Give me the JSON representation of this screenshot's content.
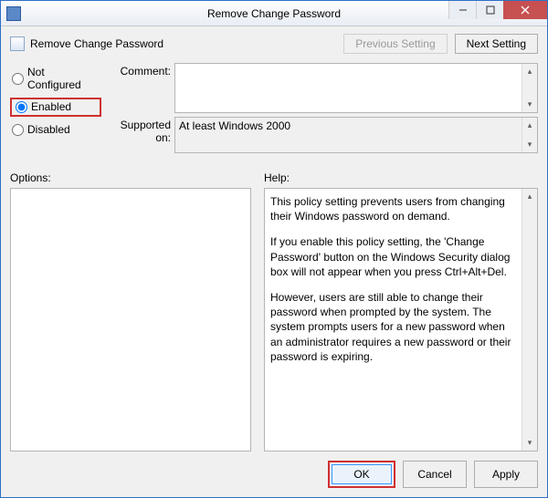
{
  "window": {
    "title": "Remove Change Password"
  },
  "header": {
    "policy_name": "Remove Change Password",
    "previous_setting": "Previous Setting",
    "next_setting": "Next Setting"
  },
  "radios": {
    "not_configured": "Not Configured",
    "enabled": "Enabled",
    "disabled": "Disabled",
    "selected": "enabled"
  },
  "labels": {
    "comment": "Comment:",
    "supported_on": "Supported on:",
    "options": "Options:",
    "help": "Help:"
  },
  "fields": {
    "comment": "",
    "supported_on": "At least Windows 2000"
  },
  "help": {
    "p1": "This policy setting prevents users from changing their Windows password on demand.",
    "p2": "If you enable this policy setting,  the 'Change Password' button on the Windows Security dialog box will not appear when you press Ctrl+Alt+Del.",
    "p3": "However, users are still able to change their password when prompted by the system. The system prompts users for a new password when an administrator requires a new password or their password is expiring."
  },
  "footer": {
    "ok": "OK",
    "cancel": "Cancel",
    "apply": "Apply"
  }
}
